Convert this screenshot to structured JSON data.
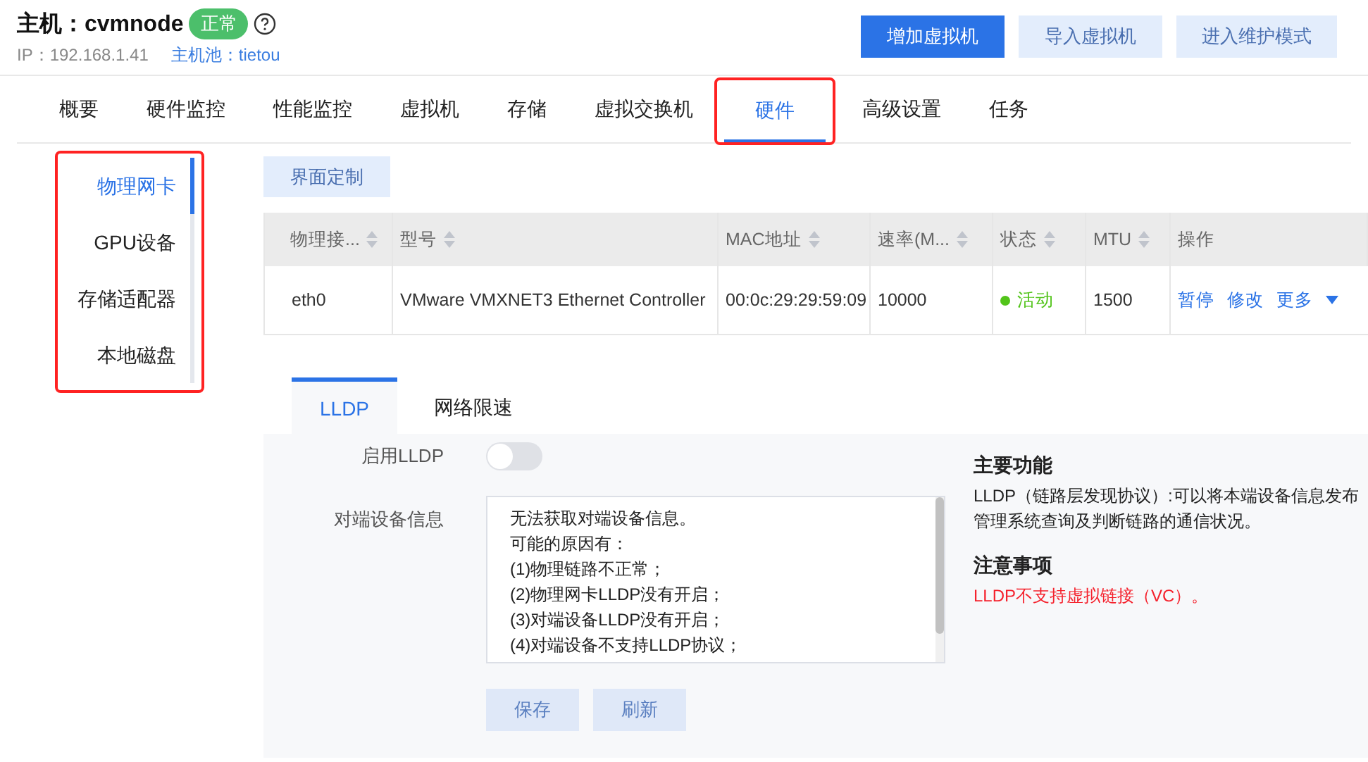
{
  "host": {
    "label": "主机：cvmnode",
    "status": "正常",
    "ip": "IP：192.168.1.41",
    "pool": "主机池：tietou"
  },
  "actions": [
    {
      "label": "增加虚拟机",
      "kind": "primary"
    },
    {
      "label": "导入虚拟机",
      "kind": "secondary"
    },
    {
      "label": "进入维护模式",
      "kind": "secondary"
    }
  ],
  "tabs": [
    {
      "label": "概要",
      "selected": false,
      "highlighted": false
    },
    {
      "label": "硬件监控",
      "selected": false,
      "highlighted": false
    },
    {
      "label": "性能监控",
      "selected": false,
      "highlighted": false
    },
    {
      "label": "虚拟机",
      "selected": false,
      "highlighted": false
    },
    {
      "label": "存储",
      "selected": false,
      "highlighted": false
    },
    {
      "label": "虚拟交换机",
      "selected": false,
      "highlighted": false
    },
    {
      "label": "硬件",
      "selected": true,
      "highlighted": true
    },
    {
      "label": "高级设置",
      "selected": false,
      "highlighted": false
    },
    {
      "label": "任务",
      "selected": false,
      "highlighted": false
    }
  ],
  "sidebar": {
    "highlighted": true,
    "items": [
      {
        "label": "物理网卡",
        "selected": true
      },
      {
        "label": "GPU设备",
        "selected": false
      },
      {
        "label": "存储适配器",
        "selected": false
      },
      {
        "label": "本地磁盘",
        "selected": false
      }
    ]
  },
  "customize_button": "界面定制",
  "table": {
    "columns": [
      {
        "label": "物理接...",
        "sortable": true
      },
      {
        "label": "型号",
        "sortable": true
      },
      {
        "label": "MAC地址",
        "sortable": true
      },
      {
        "label": "速率(M...",
        "sortable": true
      },
      {
        "label": "状态",
        "sortable": true
      },
      {
        "label": "MTU",
        "sortable": true
      },
      {
        "label": "操作",
        "sortable": false
      }
    ],
    "rows": [
      {
        "interface": "eth0",
        "model": "VMware VMXNET3 Ethernet Controller",
        "mac": "00:0c:29:29:59:09",
        "speed": "10000",
        "status": "活动",
        "color": "#52c41a",
        "mtu": "1500",
        "ops": [
          "暂停",
          "修改",
          "更多"
        ]
      }
    ]
  },
  "subtabs": [
    {
      "label": "LLDP",
      "selected": true
    },
    {
      "label": "网络限速",
      "selected": false
    }
  ],
  "lldp": {
    "enable_label": "启用LLDP",
    "enabled": false,
    "peer_label": "对端设备信息",
    "peer_lines": [
      "无法获取对端设备信息。",
      "可能的原因有：",
      "(1)物理链路不正常；",
      "(2)物理网卡LLDP没有开启；",
      "(3)对端设备LLDP没有开启；",
      "(4)对端设备不支持LLDP协议；"
    ],
    "buttons": [
      "保存",
      "刷新"
    ]
  },
  "info": [
    {
      "title": "主要功能",
      "lines": [
        "LLDP（链路层发现协议）:可以将本端设备信息发布",
        "管理系统查询及判断链路的通信状况。"
      ],
      "kind": "normal"
    },
    {
      "title": "注意事项",
      "lines": [
        "LLDP不支持虚拟链接（VC）。"
      ],
      "kind": "warning"
    }
  ]
}
